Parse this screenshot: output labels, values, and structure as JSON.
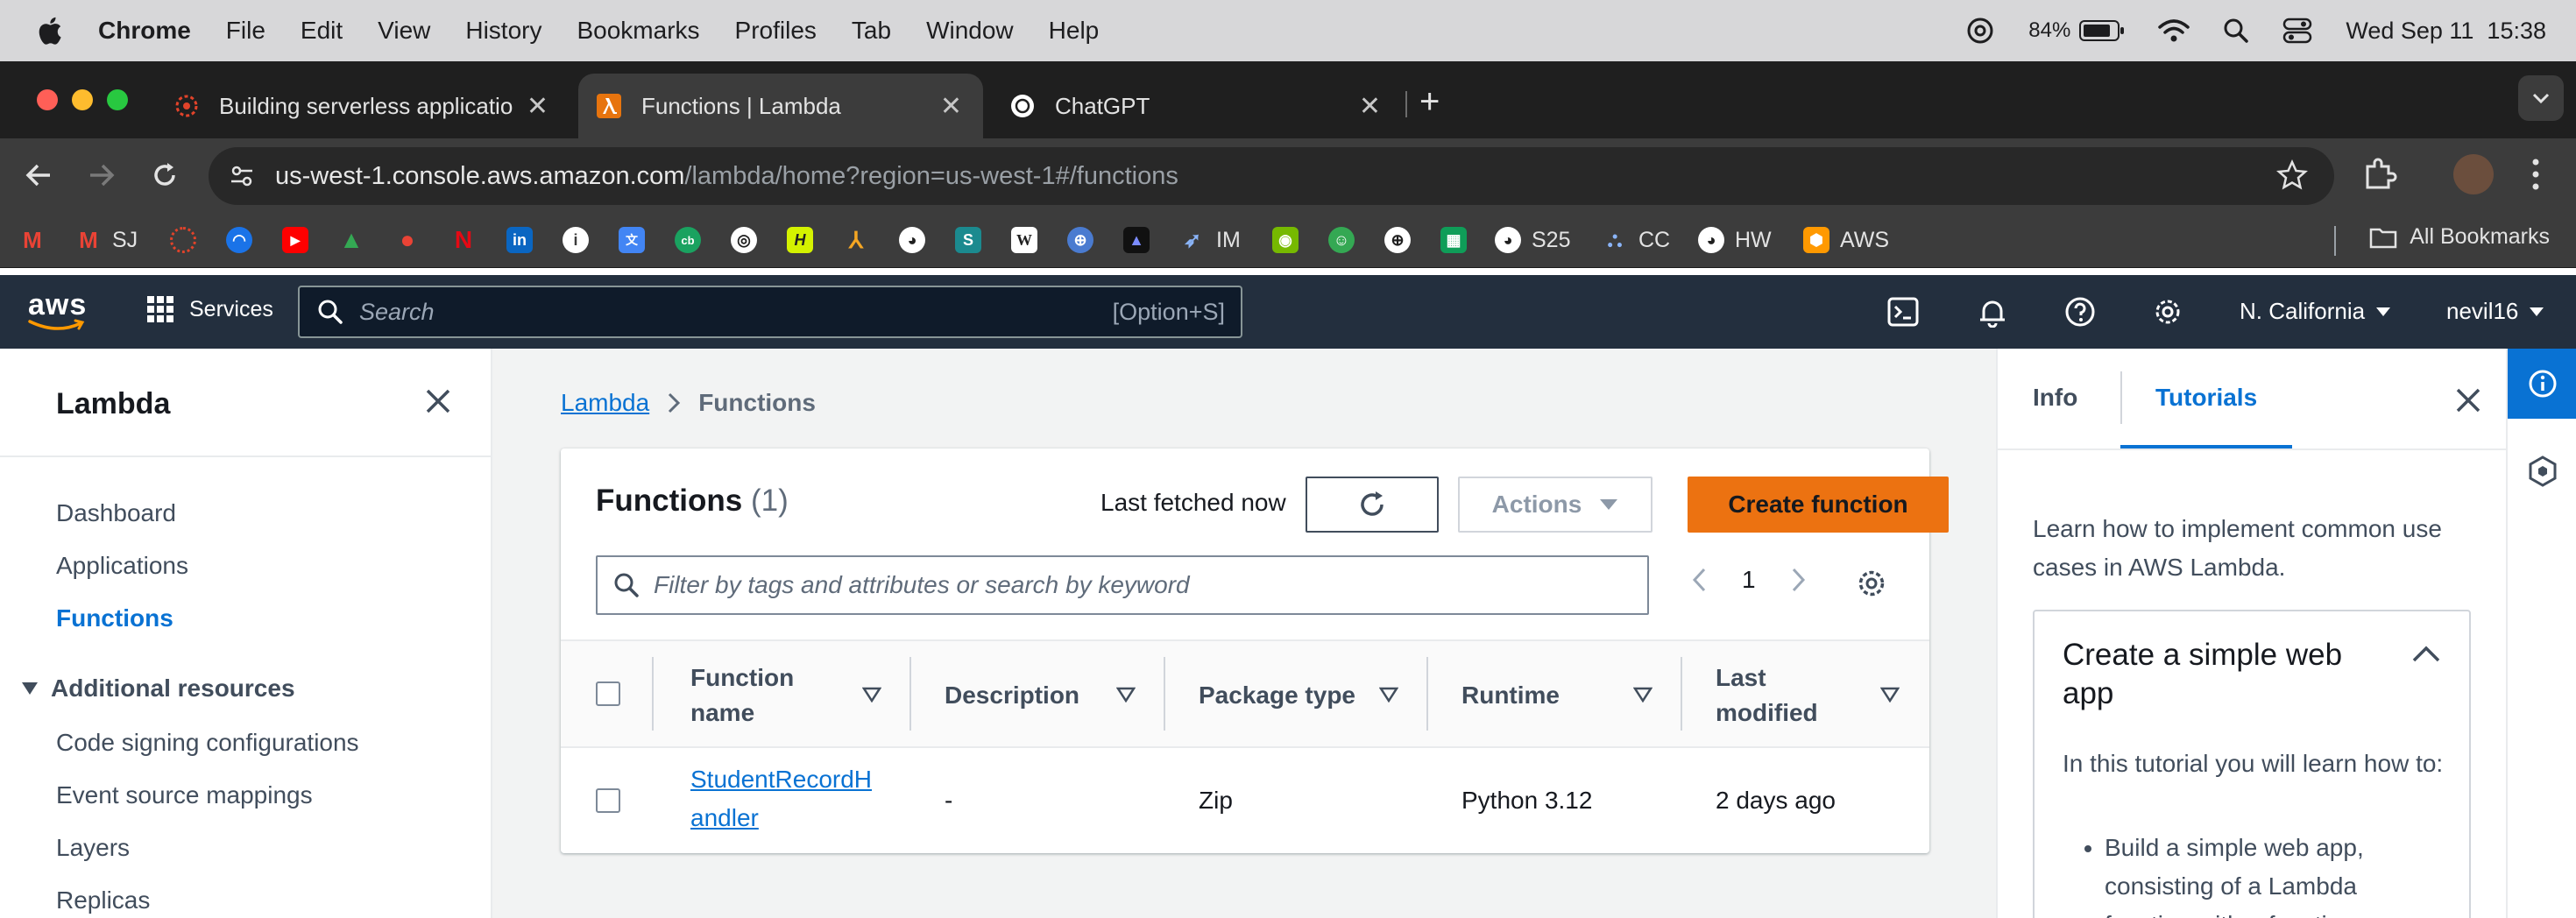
{
  "menubar": {
    "app": "Chrome",
    "items": [
      "File",
      "Edit",
      "View",
      "History",
      "Bookmarks",
      "Profiles",
      "Tab",
      "Window",
      "Help"
    ],
    "battery": "84%",
    "datetime": "Wed Sep 11  15:38"
  },
  "tabs": [
    {
      "title": "Building serverless applicatio"
    },
    {
      "title": "Functions | Lambda"
    },
    {
      "title": "ChatGPT"
    }
  ],
  "address": {
    "host": "us-west-1.console.aws.amazon.com",
    "path": "/lambda/home?region=us-west-1#/functions"
  },
  "bookmarks": {
    "items": [
      {
        "label": "SJ"
      },
      {
        "label": "IM"
      },
      {
        "label": "S25"
      },
      {
        "label": "CC"
      },
      {
        "label": "HW"
      },
      {
        "label": "AWS"
      }
    ],
    "all_label": "All Bookmarks"
  },
  "aws_header": {
    "logo": "aws",
    "services_label": "Services",
    "search_placeholder": "Search",
    "search_shortcut": "[Option+S]",
    "region": "N. California",
    "user": "nevil16"
  },
  "leftnav": {
    "title": "Lambda",
    "links": [
      "Dashboard",
      "Applications",
      "Functions"
    ],
    "section_title": "Additional resources",
    "section_links": [
      "Code signing configurations",
      "Event source mappings",
      "Layers",
      "Replicas"
    ]
  },
  "main": {
    "breadcrumb": {
      "root": "Lambda",
      "current": "Functions"
    },
    "panel_title": "Functions",
    "count": "(1)",
    "last_fetched": "Last fetched now",
    "actions_label": "Actions",
    "create_label": "Create function",
    "filter_placeholder": "Filter by tags and attributes or search by keyword",
    "page": "1",
    "columns": {
      "name_l1": "Function",
      "name_l2": "name",
      "description": "Description",
      "package": "Package type",
      "runtime": "Runtime",
      "modified_l1": "Last",
      "modified_l2": "modified"
    },
    "rows": [
      {
        "name_l1": "StudentRecordH",
        "name_l2": "andler",
        "description": "-",
        "package": "Zip",
        "runtime": "Python 3.12",
        "modified": "2 days ago"
      }
    ]
  },
  "help": {
    "tab_info": "Info",
    "tab_tutorials": "Tutorials",
    "intro": "Learn how to implement common use cases in AWS Lambda.",
    "tutorial_title": "Create a simple web app",
    "tutorial_desc": "In this tutorial you will learn how to:",
    "tutorial_bullets": [
      "Build a simple web app, consisting of a Lambda function with a function"
    ]
  },
  "colors": {
    "aws_nav": "#232f3e",
    "accent": "#0972d3",
    "primary_button": "#ec7211"
  }
}
